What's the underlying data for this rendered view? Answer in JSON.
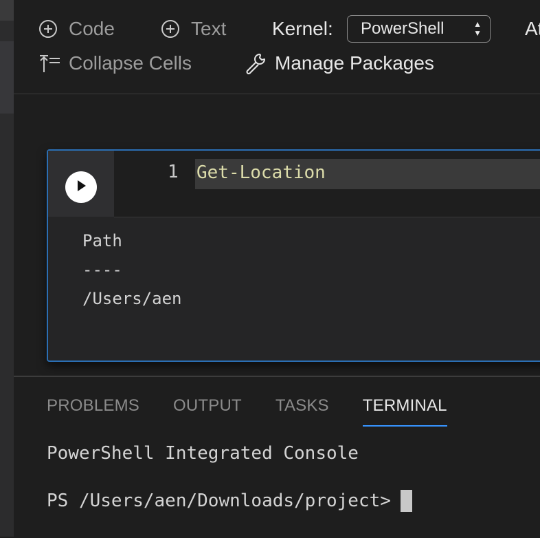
{
  "toolbar": {
    "add_code_label": "Code",
    "add_text_label": "Text",
    "kernel_label": "Kernel:",
    "kernel_value": "PowerShell",
    "attach_label_partial": "At",
    "collapse_label": "Collapse Cells",
    "manage_label": "Manage Packages"
  },
  "cell": {
    "line_number": "1",
    "code": "Get-Location",
    "output": [
      "Path",
      "----",
      "/Users/aen"
    ]
  },
  "panel": {
    "tabs": [
      "PROBLEMS",
      "OUTPUT",
      "TASKS",
      "TERMINAL"
    ],
    "active_tab": "TERMINAL",
    "terminal_title": "PowerShell Integrated Console",
    "prompt": "PS /Users/aen/Downloads/project>"
  },
  "colors": {
    "accent": "#3794ff",
    "cell_border": "#2b6fb4",
    "code_text": "#dcdcaa"
  }
}
